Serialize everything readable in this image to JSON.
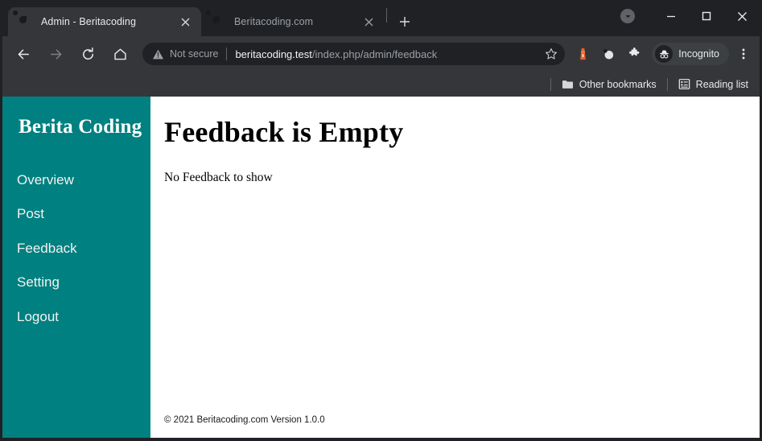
{
  "browser": {
    "tabs": [
      {
        "title": "Admin - Beritacoding",
        "favicon": "globe-icon",
        "active": true
      },
      {
        "title": "Beritacoding.com",
        "favicon": "globe-icon",
        "active": false
      }
    ],
    "new_tab_label": "+",
    "window_controls": {
      "update_label": "update-available",
      "minimize_label": "Minimize",
      "maximize_label": "Maximize",
      "close_label": "Close"
    },
    "toolbar": {
      "back_label": "Back",
      "forward_label": "Forward",
      "reload_label": "Reload",
      "home_label": "Home",
      "security_status": "Not secure",
      "url_host": "beritacoding.test",
      "url_path": "/index.php/admin/feedback",
      "bookmark_label": "Bookmark this tab",
      "extensions": [
        "lighthouse-icon",
        "sphere-extension-icon",
        "puzzle-extensions-icon"
      ],
      "incognito_label": "Incognito",
      "menu_label": "Customize and control Google Chrome"
    },
    "bookmarks_bar": {
      "items": [
        {
          "label": "Other bookmarks",
          "icon": "folder-icon"
        },
        {
          "label": "Reading list",
          "icon": "reading-list-icon"
        }
      ]
    }
  },
  "page": {
    "sidebar": {
      "brand": "Berita Coding",
      "background_color": "#008080",
      "items": [
        {
          "label": "Overview"
        },
        {
          "label": "Post"
        },
        {
          "label": "Feedback"
        },
        {
          "label": "Setting"
        },
        {
          "label": "Logout"
        }
      ]
    },
    "main": {
      "heading": "Feedback is Empty",
      "body_text": "No Feedback to show",
      "footer": "© 2021 Beritacoding.com Version 1.0.0"
    }
  }
}
